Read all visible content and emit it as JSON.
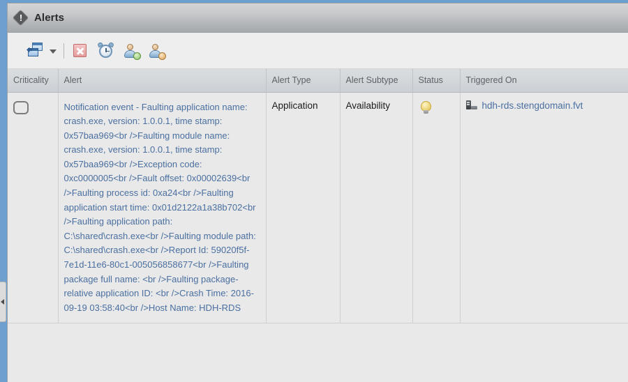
{
  "window": {
    "title": "Alerts",
    "title_icon": "alert-diamond-icon"
  },
  "toolbar": {
    "buttons": [
      {
        "name": "cascade-windows-button",
        "icon": "windows-cascade-icon",
        "tooltip": "Actions"
      },
      {
        "name": "toolbar-dropdown-arrow",
        "icon": "chevron-down-icon",
        "tooltip": "More actions"
      },
      {
        "name": "close-alert-button",
        "icon": "red-x-icon",
        "tooltip": "Close Alert"
      },
      {
        "name": "snooze-alert-button",
        "icon": "alarm-clock-icon",
        "tooltip": "Snooze Alert"
      },
      {
        "name": "assign-alert-button",
        "icon": "user-add-icon",
        "tooltip": "Assign Alert"
      },
      {
        "name": "unassign-alert-button",
        "icon": "user-edit-icon",
        "tooltip": "Unassign Alert"
      }
    ]
  },
  "table": {
    "columns": [
      "Criticality",
      "Alert",
      "Alert Type",
      "Alert Subtype",
      "Status",
      "Triggered On"
    ],
    "rows": [
      {
        "criticality": "",
        "criticality_icon": "criticality-octagon-icon",
        "alert": "Notification event - Faulting application name: crash.exe, version: 1.0.0.1, time stamp: 0x57baa969<br />Faulting module name: crash.exe, version: 1.0.0.1, time stamp: 0x57baa969<br />Exception code: 0xc0000005<br />Fault offset: 0x00002639<br />Faulting process id: 0xa24<br />Faulting application start time: 0x01d2122a1a38b702<br />Faulting application path: C:\\shared\\crash.exe<br />Faulting module path: C:\\shared\\crash.exe<br />Report Id: 59020f5f-7e1d-11e6-80c1-005056858677<br />Faulting package full name: <br />Faulting package-relative application ID: <br />Crash Time: 2016-09-19 03:58:40<br />Host Name: HDH-RDS",
        "alert_type": "Application",
        "alert_subtype": "Availability",
        "status_icon": "lightbulb-icon",
        "triggered_on": "hdh-rds.stengdomain.fvt",
        "triggered_on_icon": "server-icon"
      }
    ]
  },
  "left_panel": {
    "collapse_handle_icon": "chevron-left-icon"
  },
  "colors": {
    "page_background": "#6a9fd0",
    "panel_background": "#e9e9e9",
    "link": "#4a6fa0",
    "header": "#d4d7da"
  }
}
